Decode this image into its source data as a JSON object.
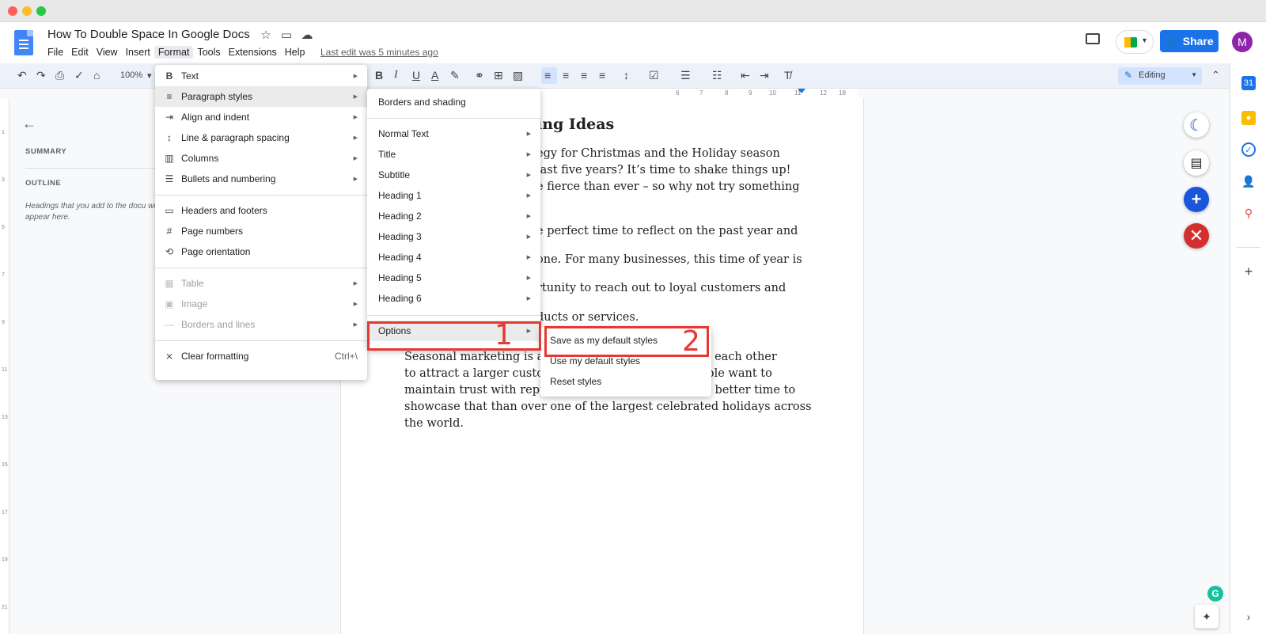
{
  "doc": {
    "title": "How To Double Space In Google Docs",
    "last_edit": "Last edit was 5 minutes ago"
  },
  "menubar": [
    "File",
    "Edit",
    "View",
    "Insert",
    "Format",
    "Tools",
    "Extensions",
    "Help"
  ],
  "header": {
    "share_label": "Share",
    "avatar_initial": "M"
  },
  "toolbar": {
    "zoom": "100%",
    "mode": "Editing"
  },
  "outline": {
    "summary_label": "SUMMARY",
    "outline_label": "OUTLINE",
    "hint": "Headings that you add to the docu will appear here."
  },
  "document": {
    "heading": "ing Ideas",
    "lines": [
      "egy for Christmas and the Holiday season",
      "last five years? It’s time to shake things up!",
      "e fierce than ever – so why not try something",
      "e perfect time to reflect on the past year and",
      "one. For many businesses, this time of year is",
      "rtunity to reach out to loyal customers and",
      "ducts or services."
    ],
    "para2": [
      "Seasonal marketing is a",
      "om each other",
      "to attract a larger custo",
      "eople want to",
      "maintain trust with reputable brands, and there’s no better time to",
      "showcase that than over one of the largest celebrated holidays across",
      "the world."
    ]
  },
  "format_menu": {
    "items": [
      {
        "label": "Text",
        "icon": "B"
      },
      {
        "label": "Paragraph styles",
        "icon": "≡"
      },
      {
        "label": "Align and indent",
        "icon": "⇥"
      },
      {
        "label": "Line & paragraph spacing",
        "icon": "↕"
      },
      {
        "label": "Columns",
        "icon": "▥"
      },
      {
        "label": "Bullets and numbering",
        "icon": "☰"
      },
      {
        "label": "Headers and footers",
        "icon": "▭"
      },
      {
        "label": "Page numbers",
        "icon": "#"
      },
      {
        "label": "Page orientation",
        "icon": "⟲"
      },
      {
        "label": "Table",
        "icon": "▦"
      },
      {
        "label": "Image",
        "icon": "▣"
      },
      {
        "label": "Borders and lines",
        "icon": "—"
      },
      {
        "label": "Clear formatting",
        "icon": "⨯",
        "shortcut": "Ctrl+\\"
      }
    ]
  },
  "paragraph_styles_menu": {
    "items": [
      "Borders and shading",
      "Normal Text",
      "Title",
      "Subtitle",
      "Heading 1",
      "Heading 2",
      "Heading 3",
      "Heading 4",
      "Heading 5",
      "Heading 6",
      "Options"
    ]
  },
  "options_menu": {
    "items": [
      "Save as my default styles",
      "Use my default styles",
      "Reset styles"
    ]
  },
  "annotations": {
    "step1": "1",
    "step2": "2"
  },
  "colors": {
    "accent": "#1a73e8",
    "annotation": "#e53935",
    "avatar": "#8e24aa"
  }
}
